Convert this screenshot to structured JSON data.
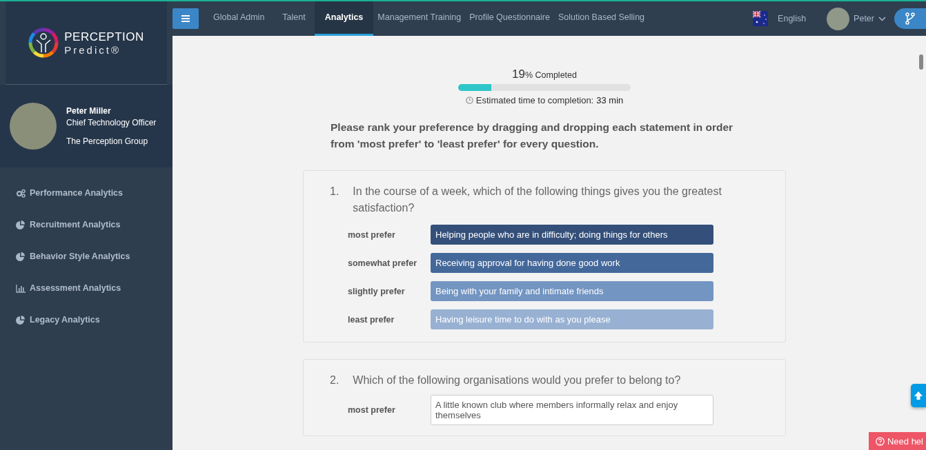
{
  "brand": {
    "name": "PERCEPTION",
    "sub": "Predict",
    "mark": "®"
  },
  "profile": {
    "name": "Peter Miller",
    "role": "Chief Technology Officer",
    "company": "The Perception Group"
  },
  "sidebar": {
    "items": [
      {
        "label": "Performance Analytics",
        "kind": "gears"
      },
      {
        "label": "Recruitment Analytics",
        "kind": "pie"
      },
      {
        "label": "Behavior Style Analytics",
        "kind": "pie"
      },
      {
        "label": "Assessment Analytics",
        "kind": "bars"
      },
      {
        "label": "Legacy Analytics",
        "kind": "pie"
      }
    ]
  },
  "tabs": [
    {
      "label": "Global Admin",
      "selected": false
    },
    {
      "label": "Talent",
      "selected": false
    },
    {
      "label": "Analytics",
      "selected": true
    },
    {
      "label": "Management Training",
      "selected": false
    },
    {
      "label": "Profile Questionnaire",
      "selected": false
    },
    {
      "label": "Solution Based Selling",
      "selected": false
    }
  ],
  "language": "English",
  "user": "Peter",
  "progress": {
    "percent": "19",
    "label": "% Completed",
    "level": 0.19
  },
  "estimate": {
    "label": "Estimated time to completion:",
    "value": "33 min"
  },
  "instructions": "Please rank your preference by dragging and dropping each statement in order from 'most prefer' to 'least prefer' for every question.",
  "questions": [
    {
      "number": "1.",
      "text": "In the course of a week, which of the following things gives you the greatest satisfaction?",
      "options": [
        {
          "rank": "most prefer",
          "text": "Helping people who are in difficulty; doing things for others",
          "color": "#34507a"
        },
        {
          "rank": "somewhat prefer",
          "text": "Receiving approval for having done good work",
          "color": "#44689a"
        },
        {
          "rank": "slightly prefer",
          "text": "Being with your family and intimate friends",
          "color": "#7395c2"
        },
        {
          "rank": "least prefer",
          "text": "Having leisure time to do with as you please",
          "color": "#98b1d3"
        }
      ]
    },
    {
      "number": "2.",
      "text": "Which of the following organisations would you prefer to belong to?",
      "options": [
        {
          "rank": "most prefer",
          "text": "A little known club where members informally relax and enjoy themselves"
        }
      ]
    }
  ],
  "help": "Need hel"
}
